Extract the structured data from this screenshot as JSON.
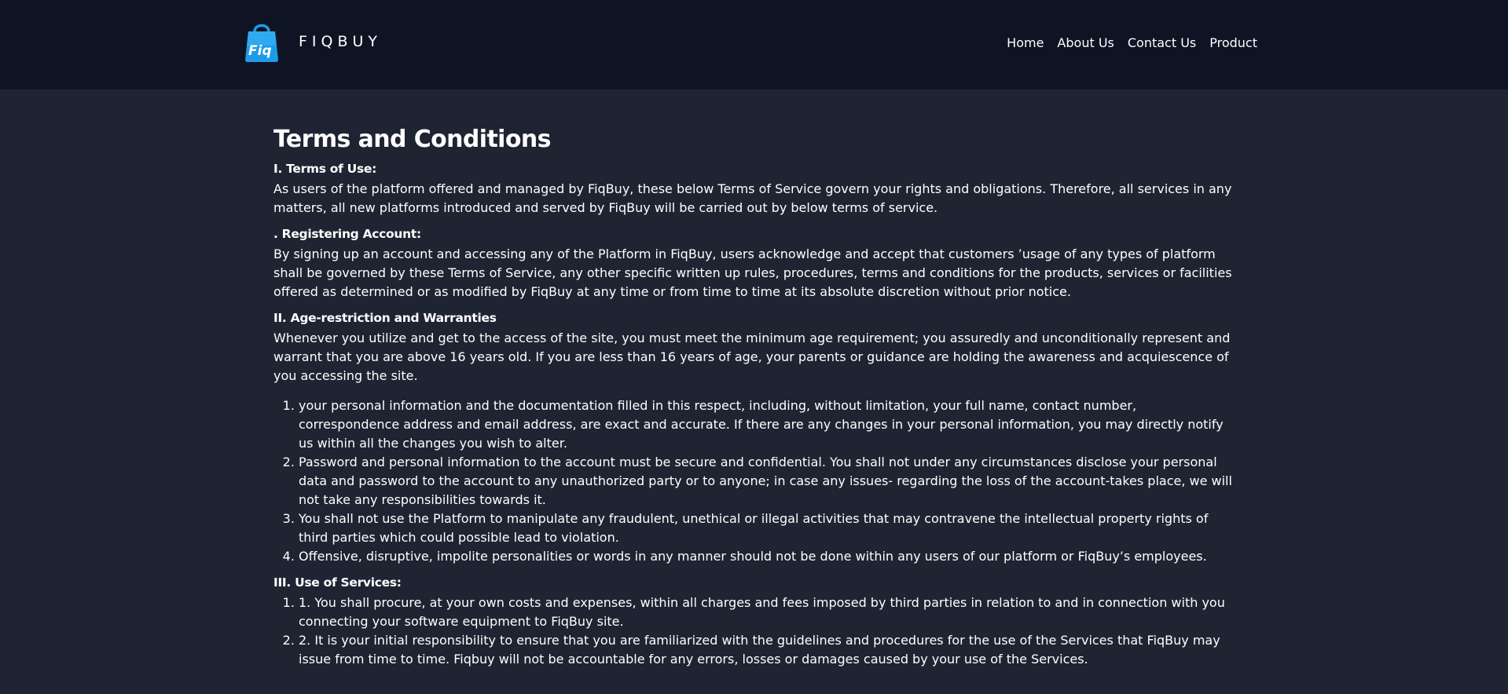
{
  "header": {
    "brand_name": "FIQBUY",
    "logo_text": "Fiq",
    "nav": [
      {
        "label": "Home"
      },
      {
        "label": "About Us"
      },
      {
        "label": "Contact Us"
      },
      {
        "label": "Product"
      }
    ]
  },
  "main": {
    "title": "Terms and Conditions",
    "sections": [
      {
        "heading": "I. Terms of Use:",
        "text": "As users of the platform offered and managed by FiqBuy, these below Terms of Service govern your rights and obligations. Therefore, all services in any matters, all new platforms introduced and served by FiqBuy will be carried out by below terms of service."
      },
      {
        "heading": ". Registering Account:",
        "text": "By signing up an account and accessing any of the Platform in FiqBuy, users acknowledge and accept that customers ’usage of any types of platform shall be governed by these Terms of Service, any other specific written up rules, procedures, terms and conditions for the products, services or facilities offered as determined or as modified by FiqBuy at any time or from time to time at its absolute discretion without prior notice."
      },
      {
        "heading": "II. Age-restriction and Warranties",
        "text": "Whenever you utilize and get to the access of the site, you must meet the minimum age requirement; you assuredly and unconditionally represent and warrant that you are above 16 years old. If you are less than 16 years of age, your parents or guidance are holding the awareness and acquiescence of you accessing the site.",
        "items": [
          "your personal information and the documentation filled in this respect, including, without limitation, your full name, contact number, correspondence address and email address, are exact and accurate. If there are any changes in your personal information, you may directly notify us within all the changes you wish to alter.",
          "Password and personal information to the account must be secure and confidential. You shall not under any circumstances disclose your personal data and password to the account to any unauthorized party or to anyone; in case any issues- regarding the loss of the account-takes place, we will not take any responsibilities towards it.",
          "You shall not use the Platform to manipulate any fraudulent, unethical or illegal activities that may contravene the intellectual property rights of third parties which could possible lead to violation.",
          "Offensive, disruptive, impolite personalities or words in any manner should not be done within any users of our platform or FiqBuy’s employees."
        ]
      },
      {
        "heading": "III. Use of Services:",
        "items": [
          "1. You shall procure, at your own costs and expenses, within all charges and fees imposed by third parties in relation to and in connection with you connecting your software equipment to FiqBuy site.",
          "2. It is your initial responsibility to ensure that you are familiarized with the guidelines and procedures for the use of the Services that FiqBuy may issue from time to time. Fiqbuy will not be accountable for any errors, losses or damages caused by your use of the Services."
        ]
      }
    ]
  },
  "colors": {
    "header_bg": "#0f1424",
    "page_bg": "#1f2432",
    "text": "#ffffff",
    "logo_blue": "#1e9be8"
  }
}
